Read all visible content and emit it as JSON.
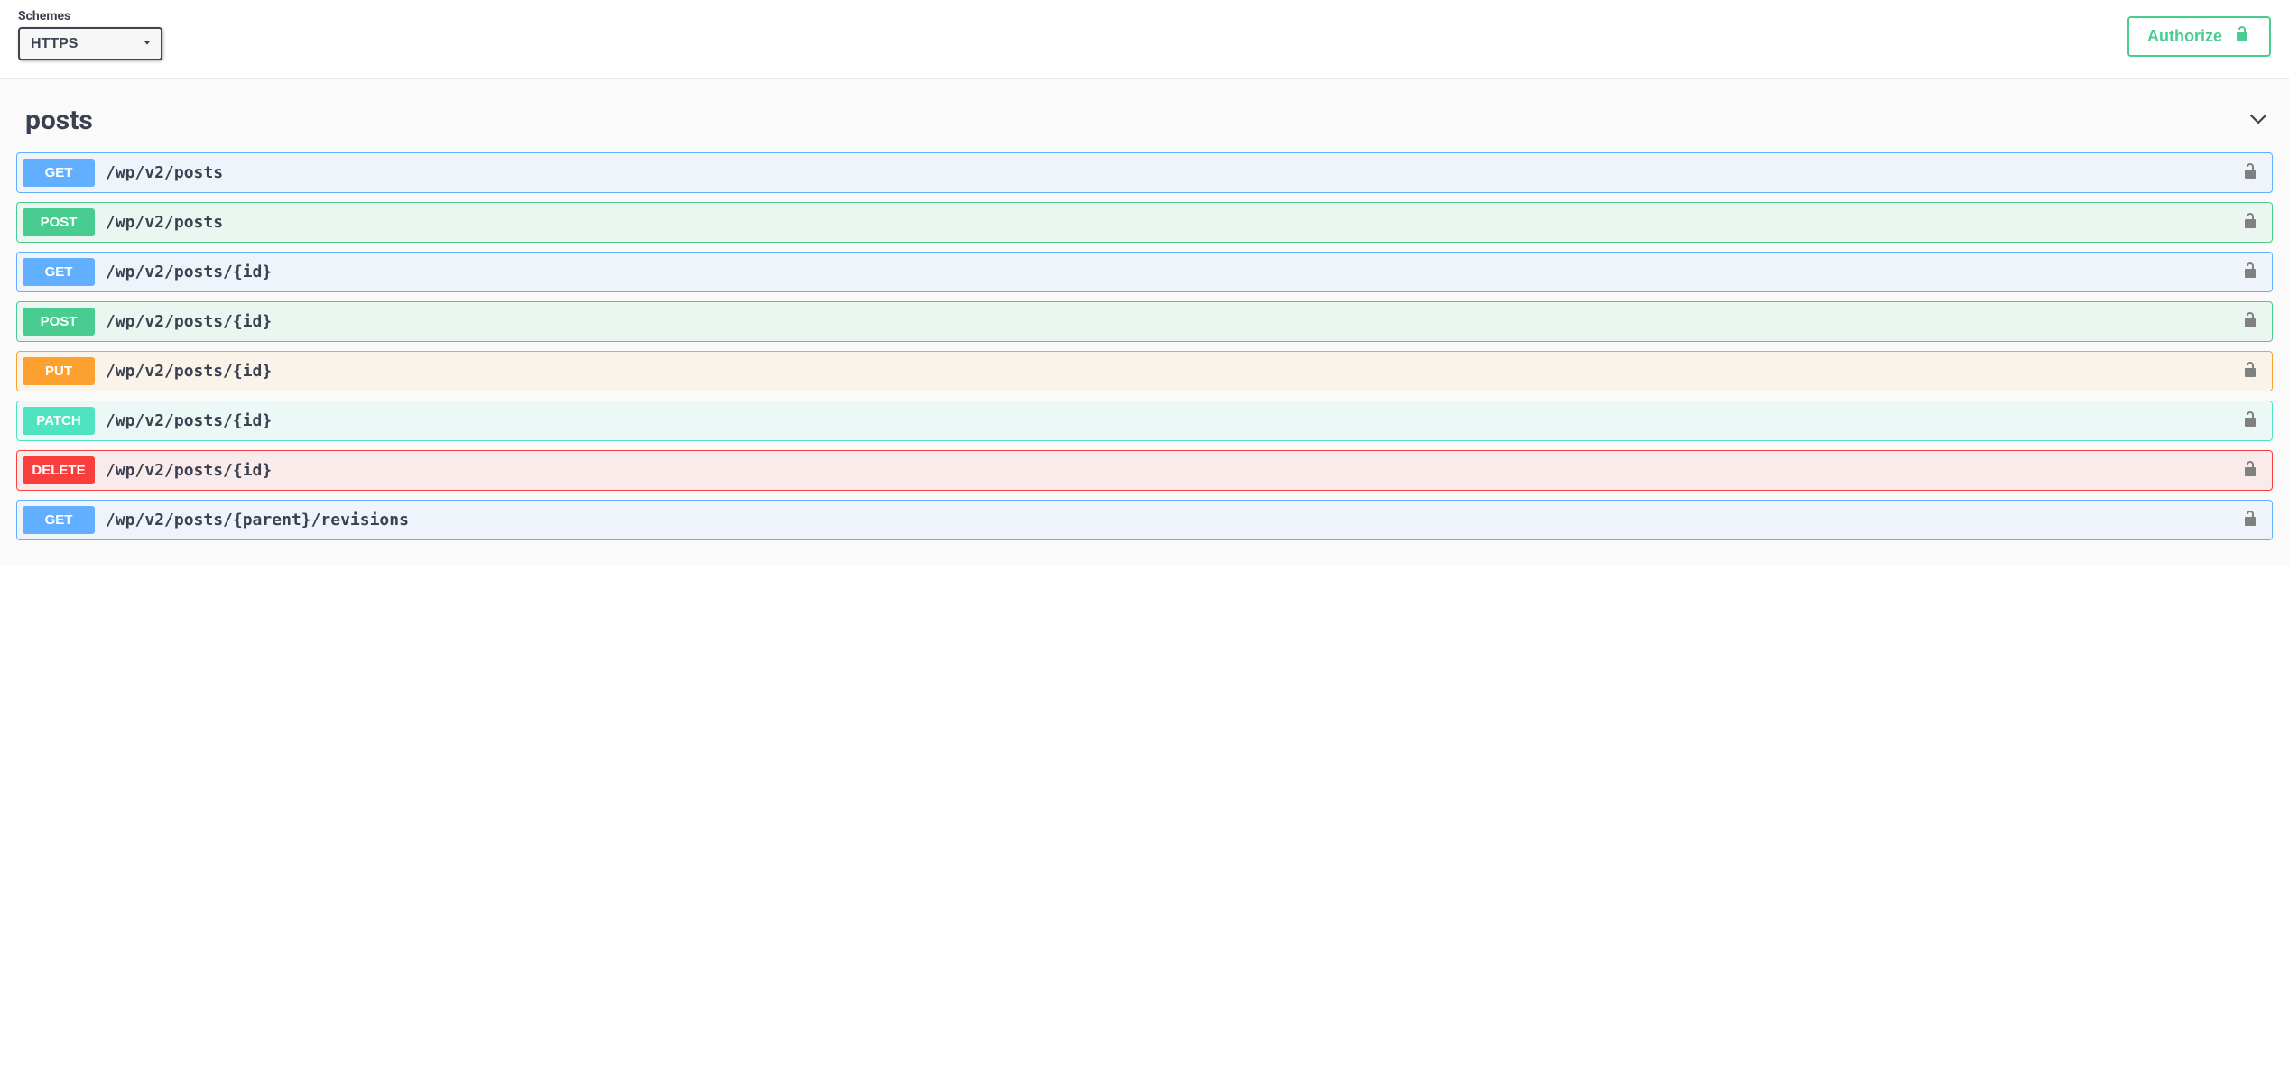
{
  "schemes": {
    "label": "Schemes",
    "selected": "HTTPS"
  },
  "authorize": {
    "label": "Authorize"
  },
  "tag": {
    "name": "posts"
  },
  "operations": [
    {
      "method": "GET",
      "class": "m-get",
      "path": "/wp/v2/posts"
    },
    {
      "method": "POST",
      "class": "m-post",
      "path": "/wp/v2/posts"
    },
    {
      "method": "GET",
      "class": "m-get",
      "path": "/wp/v2/posts/{id}"
    },
    {
      "method": "POST",
      "class": "m-post",
      "path": "/wp/v2/posts/{id}"
    },
    {
      "method": "PUT",
      "class": "m-put",
      "path": "/wp/v2/posts/{id}"
    },
    {
      "method": "PATCH",
      "class": "m-patch",
      "path": "/wp/v2/posts/{id}"
    },
    {
      "method": "DELETE",
      "class": "m-delete",
      "path": "/wp/v2/posts/{id}"
    },
    {
      "method": "GET",
      "class": "m-get",
      "path": "/wp/v2/posts/{parent}/revisions"
    }
  ]
}
